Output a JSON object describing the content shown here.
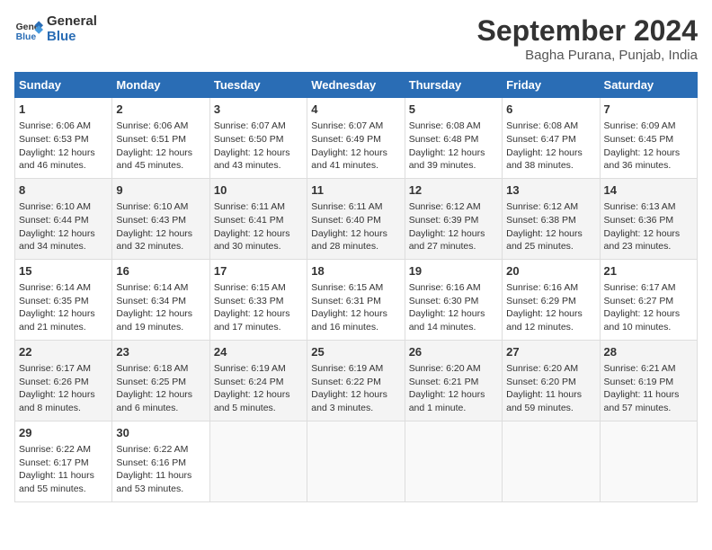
{
  "logo": {
    "line1": "General",
    "line2": "Blue"
  },
  "title": "September 2024",
  "location": "Bagha Purana, Punjab, India",
  "days_of_week": [
    "Sunday",
    "Monday",
    "Tuesday",
    "Wednesday",
    "Thursday",
    "Friday",
    "Saturday"
  ],
  "weeks": [
    [
      {
        "day": 1,
        "rise": "6:06 AM",
        "set": "6:53 PM",
        "hours": "12 hours",
        "mins": "46 minutes"
      },
      {
        "day": 2,
        "rise": "6:06 AM",
        "set": "6:51 PM",
        "hours": "12 hours",
        "mins": "45 minutes"
      },
      {
        "day": 3,
        "rise": "6:07 AM",
        "set": "6:50 PM",
        "hours": "12 hours",
        "mins": "43 minutes"
      },
      {
        "day": 4,
        "rise": "6:07 AM",
        "set": "6:49 PM",
        "hours": "12 hours",
        "mins": "41 minutes"
      },
      {
        "day": 5,
        "rise": "6:08 AM",
        "set": "6:48 PM",
        "hours": "12 hours",
        "mins": "39 minutes"
      },
      {
        "day": 6,
        "rise": "6:08 AM",
        "set": "6:47 PM",
        "hours": "12 hours",
        "mins": "38 minutes"
      },
      {
        "day": 7,
        "rise": "6:09 AM",
        "set": "6:45 PM",
        "hours": "12 hours",
        "mins": "36 minutes"
      }
    ],
    [
      {
        "day": 8,
        "rise": "6:10 AM",
        "set": "6:44 PM",
        "hours": "12 hours",
        "mins": "34 minutes"
      },
      {
        "day": 9,
        "rise": "6:10 AM",
        "set": "6:43 PM",
        "hours": "12 hours",
        "mins": "32 minutes"
      },
      {
        "day": 10,
        "rise": "6:11 AM",
        "set": "6:41 PM",
        "hours": "12 hours",
        "mins": "30 minutes"
      },
      {
        "day": 11,
        "rise": "6:11 AM",
        "set": "6:40 PM",
        "hours": "12 hours",
        "mins": "28 minutes"
      },
      {
        "day": 12,
        "rise": "6:12 AM",
        "set": "6:39 PM",
        "hours": "12 hours",
        "mins": "27 minutes"
      },
      {
        "day": 13,
        "rise": "6:12 AM",
        "set": "6:38 PM",
        "hours": "12 hours",
        "mins": "25 minutes"
      },
      {
        "day": 14,
        "rise": "6:13 AM",
        "set": "6:36 PM",
        "hours": "12 hours",
        "mins": "23 minutes"
      }
    ],
    [
      {
        "day": 15,
        "rise": "6:14 AM",
        "set": "6:35 PM",
        "hours": "12 hours",
        "mins": "21 minutes"
      },
      {
        "day": 16,
        "rise": "6:14 AM",
        "set": "6:34 PM",
        "hours": "12 hours",
        "mins": "19 minutes"
      },
      {
        "day": 17,
        "rise": "6:15 AM",
        "set": "6:33 PM",
        "hours": "12 hours",
        "mins": "17 minutes"
      },
      {
        "day": 18,
        "rise": "6:15 AM",
        "set": "6:31 PM",
        "hours": "12 hours",
        "mins": "16 minutes"
      },
      {
        "day": 19,
        "rise": "6:16 AM",
        "set": "6:30 PM",
        "hours": "12 hours",
        "mins": "14 minutes"
      },
      {
        "day": 20,
        "rise": "6:16 AM",
        "set": "6:29 PM",
        "hours": "12 hours",
        "mins": "12 minutes"
      },
      {
        "day": 21,
        "rise": "6:17 AM",
        "set": "6:27 PM",
        "hours": "12 hours",
        "mins": "10 minutes"
      }
    ],
    [
      {
        "day": 22,
        "rise": "6:17 AM",
        "set": "6:26 PM",
        "hours": "12 hours",
        "mins": "8 minutes"
      },
      {
        "day": 23,
        "rise": "6:18 AM",
        "set": "6:25 PM",
        "hours": "12 hours",
        "mins": "6 minutes"
      },
      {
        "day": 24,
        "rise": "6:19 AM",
        "set": "6:24 PM",
        "hours": "12 hours",
        "mins": "5 minutes"
      },
      {
        "day": 25,
        "rise": "6:19 AM",
        "set": "6:22 PM",
        "hours": "12 hours",
        "mins": "3 minutes"
      },
      {
        "day": 26,
        "rise": "6:20 AM",
        "set": "6:21 PM",
        "hours": "12 hours",
        "mins": "1 minute"
      },
      {
        "day": 27,
        "rise": "6:20 AM",
        "set": "6:20 PM",
        "hours": "11 hours",
        "mins": "59 minutes"
      },
      {
        "day": 28,
        "rise": "6:21 AM",
        "set": "6:19 PM",
        "hours": "11 hours",
        "mins": "57 minutes"
      }
    ],
    [
      {
        "day": 29,
        "rise": "6:22 AM",
        "set": "6:17 PM",
        "hours": "11 hours",
        "mins": "55 minutes"
      },
      {
        "day": 30,
        "rise": "6:22 AM",
        "set": "6:16 PM",
        "hours": "11 hours",
        "mins": "53 minutes"
      },
      null,
      null,
      null,
      null,
      null
    ]
  ]
}
